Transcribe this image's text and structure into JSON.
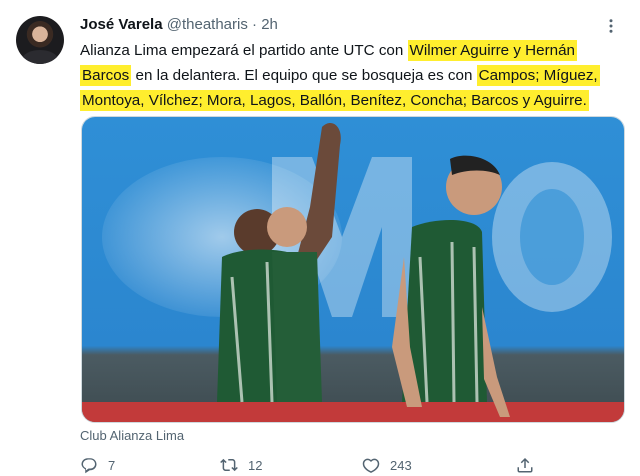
{
  "tweet": {
    "author_name": "José Varela",
    "author_handle": "@theatharis",
    "separator": "·",
    "time": "2h",
    "text_parts": {
      "p1": "Alianza Lima empezará el partido ante UTC con ",
      "h1": "Wilmer Aguirre y Hernán",
      "h2": "Barcos",
      "p2": " en la delantera. El equipo que se bosqueja es con ",
      "h3": "Campos; Míguez,",
      "h4": "Montoya, Vílchez; Mora, Lagos, Ballón, Benítez, Concha; Barcos y Aguirre."
    },
    "media_source": "Club Alianza Lima",
    "counts": {
      "replies": "7",
      "retweets": "12",
      "likes": "243"
    },
    "highlight_color": "#ffee2e",
    "icons": [
      "more-icon",
      "reply-icon",
      "retweet-icon",
      "like-icon",
      "share-icon"
    ]
  }
}
